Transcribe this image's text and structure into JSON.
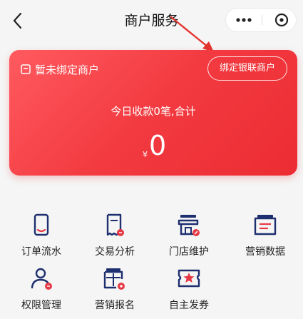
{
  "header": {
    "title": "商户服务",
    "back_icon": "chevron-left-icon",
    "more_icon": "more-dots-icon",
    "close_icon": "circle-close-icon"
  },
  "card": {
    "unbound_text": "暂未绑定商户",
    "bind_button": "绑定银联商户",
    "today_text": "今日收款0笔,合计",
    "currency": "¥",
    "amount": "0"
  },
  "services": [
    {
      "label": "订单流水",
      "icon": "order-list-icon"
    },
    {
      "label": "交易分析",
      "icon": "transaction-analysis-icon"
    },
    {
      "label": "门店维护",
      "icon": "store-maintenance-icon"
    },
    {
      "label": "营销数据",
      "icon": "marketing-data-icon"
    },
    {
      "label": "权限管理",
      "icon": "permission-management-icon"
    },
    {
      "label": "营销报名",
      "icon": "marketing-signup-icon"
    },
    {
      "label": "自主发券",
      "icon": "coupon-issue-icon"
    }
  ],
  "colors": {
    "brand_red": "#f23a40",
    "icon_navy": "#1e2f6f",
    "icon_red": "#e63946"
  }
}
